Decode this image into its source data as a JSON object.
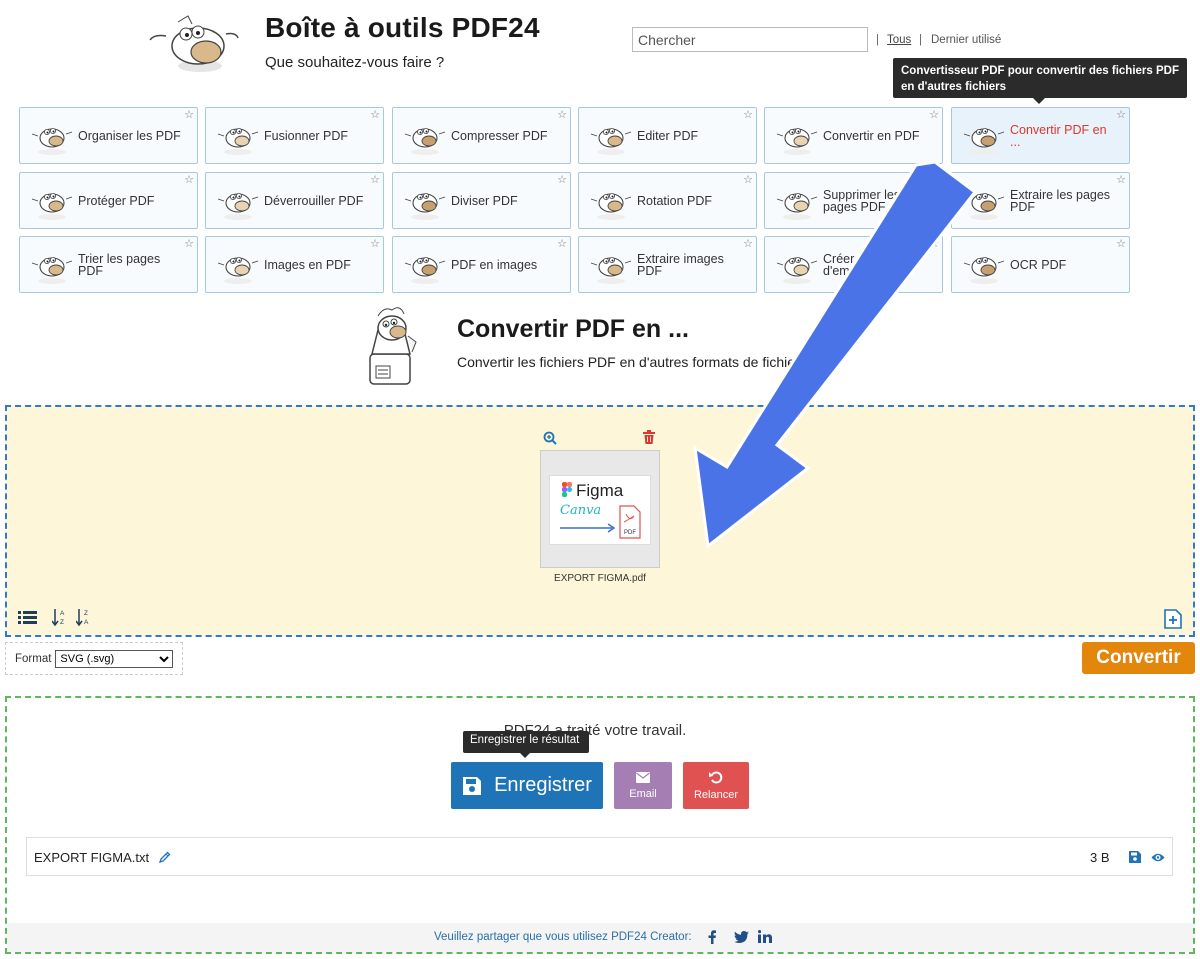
{
  "header": {
    "title": "Boîte à outils PDF24",
    "subtitle": "Que souhaitez-vous faire ?",
    "search_placeholder": "Chercher",
    "filter_all": "Tous",
    "filter_sep": "|",
    "filter_recent": "Dernier utilisé"
  },
  "tooltip_top": "Convertisseur PDF pour convertir des fichiers PDF en d'autres fichiers",
  "tools": [
    {
      "label": "Organiser les PDF"
    },
    {
      "label": "Fusionner PDF"
    },
    {
      "label": "Compresser PDF"
    },
    {
      "label": "Editer PDF"
    },
    {
      "label": "Convertir en PDF"
    },
    {
      "label": "Convertir PDF en ..."
    },
    {
      "label": "Protéger PDF"
    },
    {
      "label": "Déverrouiller PDF"
    },
    {
      "label": "Diviser PDF"
    },
    {
      "label": "Rotation PDF"
    },
    {
      "label": "Supprimer les pages PDF"
    },
    {
      "label": "Extraire les pages PDF"
    },
    {
      "label": "Trier les pages PDF"
    },
    {
      "label": "Images en PDF"
    },
    {
      "label": "PDF en images"
    },
    {
      "label": "Extraire images PDF"
    },
    {
      "label": "Créer un PDF de d'emploi"
    },
    {
      "label": "OCR PDF"
    }
  ],
  "active_tool": "Convertir PDF en ...",
  "section": {
    "title": "Convertir PDF en ...",
    "subtitle": "Convertir les fichiers PDF en d'autres formats de fichiers"
  },
  "dropzone": {
    "file_name": "EXPORT FIGMA.pdf",
    "thumb_text_figma": "Figma",
    "thumb_text_canva": "Canva",
    "thumb_text_pdf": "PDF"
  },
  "format": {
    "label": "Format",
    "selected": "SVG (.svg)"
  },
  "convert_label": "Convertir",
  "result": {
    "message": "PDF24 a traité votre travail.",
    "save_tooltip": "Enregistrer le résultat",
    "save_label": "Enregistrer",
    "email_label": "Email",
    "relancer_label": "Relancer",
    "file_name": "EXPORT FIGMA.txt",
    "file_size": "3 B"
  },
  "share_text": "Veuillez partager que vous utilisez PDF24 Creator:",
  "colors": {
    "accent_blue": "#1f74b8",
    "convert_orange": "#e2860c",
    "email_purple": "#a57fb3",
    "relancer_red": "#e05252",
    "arrow_blue": "#4b73e8"
  }
}
